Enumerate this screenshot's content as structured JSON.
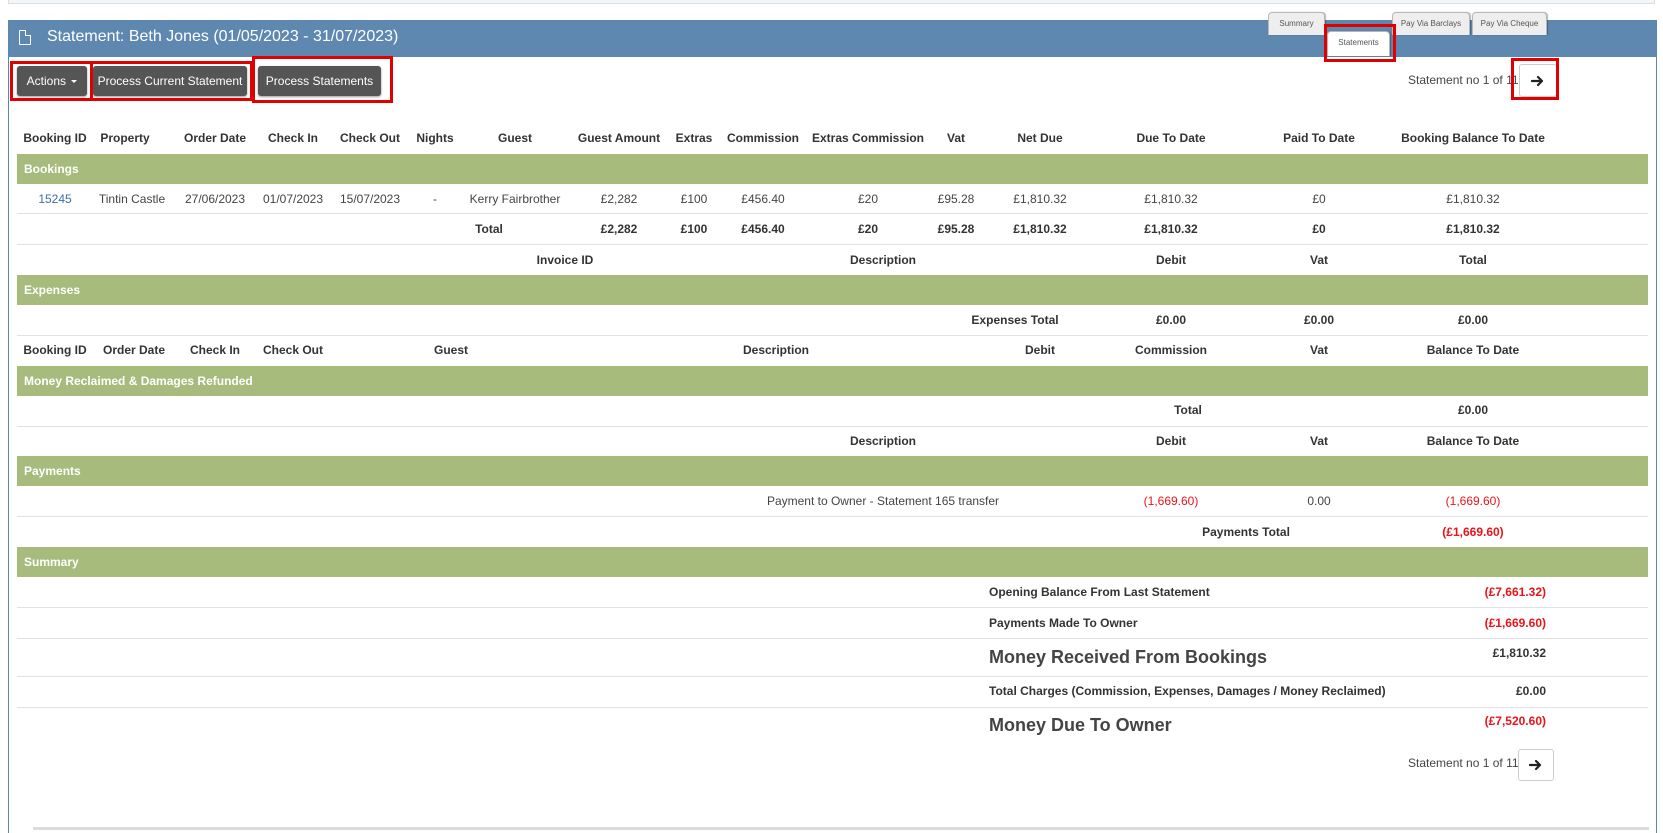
{
  "panel": {
    "title": "Statement: Beth Jones (01/05/2023 - 31/07/2023)"
  },
  "tabs": [
    {
      "label": "Summary"
    },
    {
      "label": "Statements"
    },
    {
      "label": "Pay Via Barclays"
    },
    {
      "label": "Pay Via Cheque"
    }
  ],
  "toolbar": {
    "actions_label": "Actions",
    "process_current_label": "Process Current Statement",
    "process_statements_label": "Process Statements",
    "statement_no_top": "Statement no 1 of 11",
    "statement_no_bottom": "Statement no 1 of 11"
  },
  "bookings": {
    "headers": [
      "Booking ID",
      "Property",
      "Order Date",
      "Check In",
      "Check Out",
      "Nights",
      "Guest",
      "Guest Amount",
      "Extras",
      "Commission",
      "Extras Commission",
      "Vat",
      "Net Due",
      "Due To Date",
      "Paid To Date",
      "Booking Balance To Date"
    ],
    "section_label": "Bookings",
    "row": {
      "booking_id": "15245",
      "property": "Tintin Castle",
      "order_date": "27/06/2023",
      "check_in": "01/07/2023",
      "check_out": "15/07/2023",
      "nights": "-",
      "guest": "Kerry Fairbrother",
      "guest_amount": "£2,282",
      "extras": "£100",
      "commission": "£456.40",
      "extras_commission": "£20",
      "vat": "£95.28",
      "net_due": "£1,810.32",
      "due_to_date": "£1,810.32",
      "paid_to_date": "£0",
      "balance": "£1,810.32"
    },
    "total": {
      "label": "Total",
      "guest_amount": "£2,282",
      "extras": "£100",
      "commission": "£456.40",
      "extras_commission": "£20",
      "vat": "£95.28",
      "net_due": "£1,810.32",
      "due_to_date": "£1,810.32",
      "paid_to_date": "£0",
      "balance": "£1,810.32"
    }
  },
  "expenses": {
    "headers": {
      "invoice_id": "Invoice ID",
      "description": "Description",
      "debit": "Debit",
      "vat": "Vat",
      "total": "Total"
    },
    "section_label": "Expenses",
    "total": {
      "label": "Expenses Total",
      "debit": "£0.00",
      "vat": "£0.00",
      "total": "£0.00"
    }
  },
  "reclaimed": {
    "headers": {
      "booking_id": "Booking ID",
      "order_date": "Order Date",
      "check_in": "Check In",
      "check_out": "Check Out",
      "guest": "Guest",
      "description": "Description",
      "debit": "Debit",
      "commission": "Commission",
      "vat": "Vat",
      "balance": "Balance To Date"
    },
    "section_label": "Money Reclaimed & Damages Refunded",
    "total": {
      "label": "Total",
      "value": "£0.00"
    }
  },
  "payments": {
    "headers": {
      "description": "Description",
      "debit": "Debit",
      "vat": "Vat",
      "balance": "Balance To Date"
    },
    "section_label": "Payments",
    "row": {
      "description": "Payment to Owner - Statement 165 transfer",
      "debit": "(1,669.60)",
      "vat": "0.00",
      "balance": "(1,669.60)"
    },
    "total": {
      "label": "Payments Total",
      "value": "(£1,669.60)"
    }
  },
  "summary": {
    "section_label": "Summary",
    "opening_label": "Opening Balance From Last Statement",
    "opening_value": "(£7,661.32)",
    "payments_label": "Payments Made To Owner",
    "payments_value": "(£1,669.60)",
    "received_label": "Money Received From Bookings",
    "received_value": "£1,810.32",
    "charges_label": "Total Charges (Commission, Expenses, Damages / Money Reclaimed)",
    "charges_value": "£0.00",
    "due_label": "Money Due To Owner",
    "due_value": "(£7,520.60)"
  },
  "colors": {
    "header": "#5f88b1",
    "band": "#a6bb7c",
    "negative": "#e8141a",
    "link": "#3a6ea8"
  },
  "icons": {
    "title": "document-icon",
    "next": "arrow-right-icon"
  }
}
